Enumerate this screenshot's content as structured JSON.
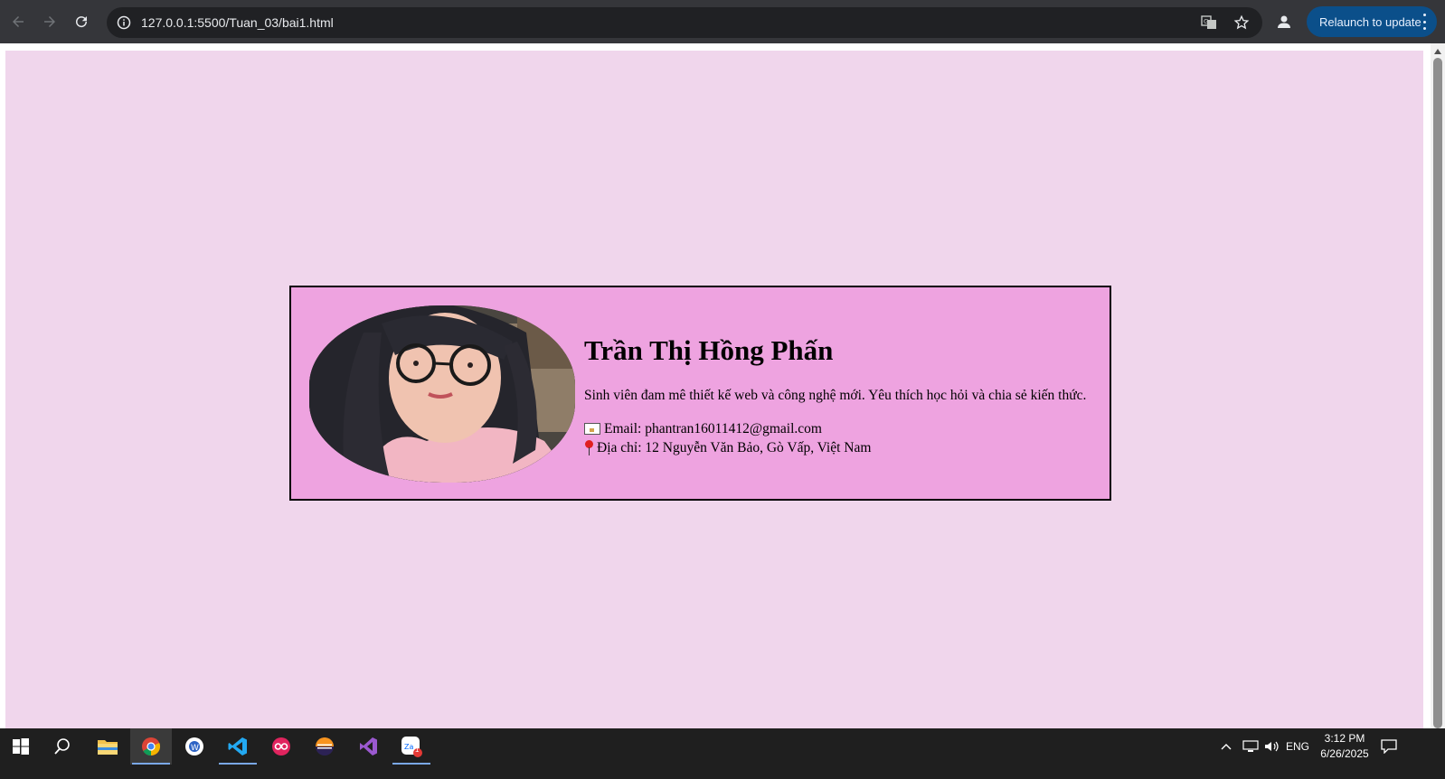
{
  "browser": {
    "url": "127.0.0.1:5500/Tuan_03/bai1.html",
    "relaunch_label": "Relaunch to update"
  },
  "profile": {
    "name": "Trần Thị Hồng Phấn",
    "bio": "Sinh viên đam mê thiết kế web và công nghệ mới. Yêu thích học hỏi và chia sẻ kiến thức.",
    "email_line": "Email: phantran16011412@gmail.com",
    "address_line": "Địa chỉ: 12 Nguyễn Văn Bảo, Gò Vấp, Việt Nam"
  },
  "taskbar": {
    "language": "ENG",
    "time": "3:12 PM",
    "date": "6/26/2025",
    "zalo_badge": "1"
  },
  "colors": {
    "page_bg": "#f0d6ec",
    "card_bg": "#eea3e0",
    "relaunch_bg": "#0b4f8a"
  }
}
